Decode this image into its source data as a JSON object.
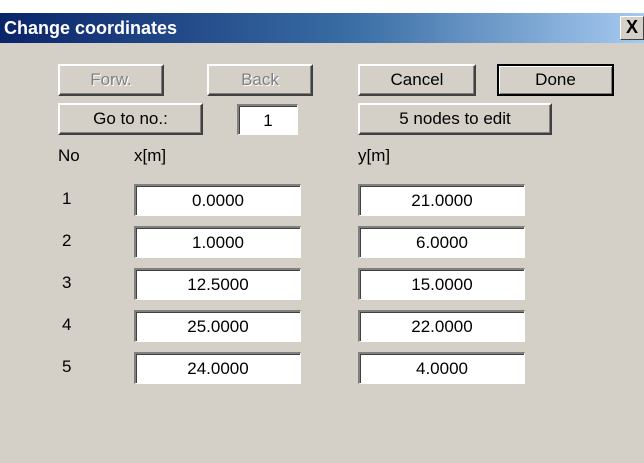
{
  "window": {
    "title": "Change coordinates",
    "close_label": "X"
  },
  "toolbar": {
    "forward_label": "Forw.",
    "back_label": "Back",
    "cancel_label": "Cancel",
    "done_label": "Done",
    "goto_label": "Go to no.:",
    "goto_value": "1",
    "nodes_label": "5 nodes to edit"
  },
  "table": {
    "headers": {
      "no": "No",
      "x": "x[m]",
      "y": "y[m]"
    },
    "rows": [
      {
        "no": "1",
        "x": "0.0000",
        "y": "21.0000"
      },
      {
        "no": "2",
        "x": "1.0000",
        "y": "6.0000"
      },
      {
        "no": "3",
        "x": "12.5000",
        "y": "15.0000"
      },
      {
        "no": "4",
        "x": "25.0000",
        "y": "22.0000"
      },
      {
        "no": "5",
        "x": "24.0000",
        "y": "4.0000"
      }
    ]
  },
  "colors": {
    "dialog_background": "#d4d0c8",
    "titlebar_start": "#0a246a",
    "titlebar_end": "#a6caf0",
    "disabled_text": "#808080"
  }
}
